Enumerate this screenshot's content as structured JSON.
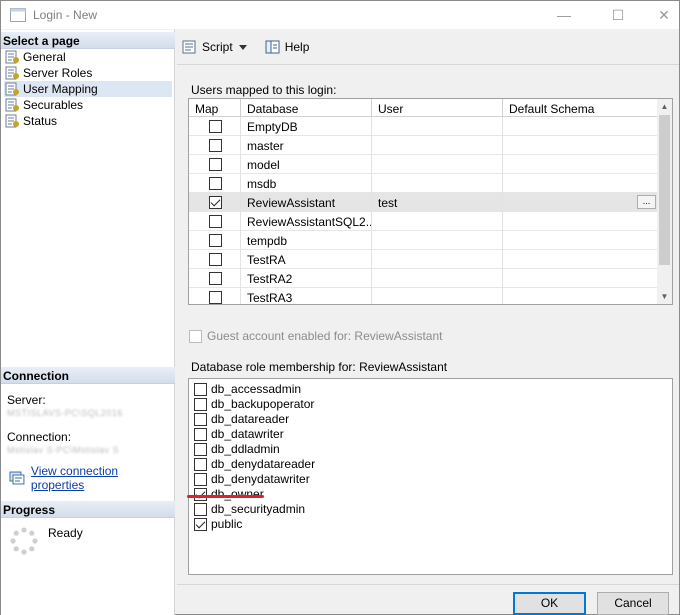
{
  "window": {
    "title": "Login - New",
    "controls": {
      "minimize": "—",
      "maximize": "☐",
      "close": "✕"
    }
  },
  "leftpane": {
    "select_page_header": "Select a page",
    "pages": [
      {
        "label": "General",
        "icon": "page-wrench-icon",
        "selected": false
      },
      {
        "label": "Server Roles",
        "icon": "page-wrench-icon",
        "selected": false
      },
      {
        "label": "User Mapping",
        "icon": "page-wrench-icon",
        "selected": true
      },
      {
        "label": "Securables",
        "icon": "page-wrench-icon",
        "selected": false
      },
      {
        "label": "Status",
        "icon": "page-wrench-icon",
        "selected": false
      }
    ],
    "connection_header": "Connection",
    "server_label": "Server:",
    "server_value": "MSTISLAVS-PC\\SQL2016",
    "connection_label": "Connection:",
    "connection_value": "Mstislav S-PC\\Mstislav S",
    "view_connection_link": "View connection properties",
    "progress_header": "Progress",
    "progress_status": "Ready"
  },
  "toolbar": {
    "script_label": "Script",
    "help_label": "Help"
  },
  "users_mapped": {
    "label": "Users mapped to this login:",
    "columns": [
      "Map",
      "Database",
      "User",
      "Default Schema"
    ],
    "rows": [
      {
        "map": false,
        "database": "EmptyDB",
        "user": "",
        "schema": ""
      },
      {
        "map": false,
        "database": "master",
        "user": "",
        "schema": ""
      },
      {
        "map": false,
        "database": "model",
        "user": "",
        "schema": ""
      },
      {
        "map": false,
        "database": "msdb",
        "user": "",
        "schema": ""
      },
      {
        "map": true,
        "database": "ReviewAssistant",
        "user": "test",
        "schema": "",
        "selected": true,
        "ellipsis": "..."
      },
      {
        "map": false,
        "database": "ReviewAssistantSQL2...",
        "user": "",
        "schema": ""
      },
      {
        "map": false,
        "database": "tempdb",
        "user": "",
        "schema": ""
      },
      {
        "map": false,
        "database": "TestRA",
        "user": "",
        "schema": ""
      },
      {
        "map": false,
        "database": "TestRA2",
        "user": "",
        "schema": ""
      },
      {
        "map": false,
        "database": "TestRA3",
        "user": "",
        "schema": ""
      }
    ]
  },
  "guest": {
    "label": "Guest account enabled for: ReviewAssistant",
    "checked": false,
    "enabled": false
  },
  "roles": {
    "label": "Database role membership for: ReviewAssistant",
    "items": [
      {
        "name": "db_accessadmin",
        "checked": false
      },
      {
        "name": "db_backupoperator",
        "checked": false
      },
      {
        "name": "db_datareader",
        "checked": false
      },
      {
        "name": "db_datawriter",
        "checked": false
      },
      {
        "name": "db_ddladmin",
        "checked": false
      },
      {
        "name": "db_denydatareader",
        "checked": false
      },
      {
        "name": "db_denydatawriter",
        "checked": false
      },
      {
        "name": "db_owner",
        "checked": true
      },
      {
        "name": "db_securityadmin",
        "checked": false
      },
      {
        "name": "public",
        "checked": true
      }
    ]
  },
  "buttons": {
    "ok": "OK",
    "cancel": "Cancel"
  }
}
